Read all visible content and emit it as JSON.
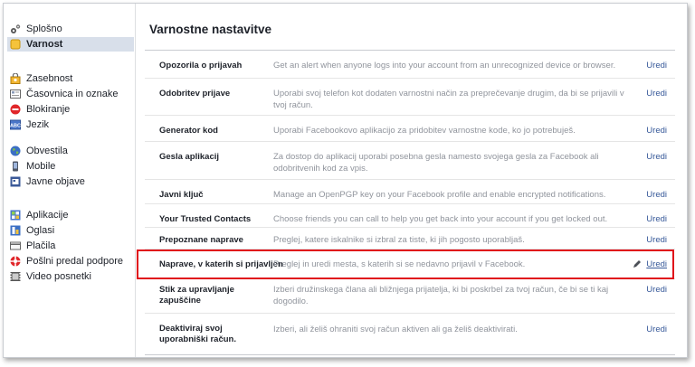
{
  "sidebar": {
    "groups": [
      [
        {
          "label": "Splošno",
          "icon": "gears-icon"
        },
        {
          "label": "Varnost",
          "icon": "shield-icon",
          "active": true
        }
      ],
      [
        {
          "label": "Zasebnost",
          "icon": "privacy-lock-icon"
        },
        {
          "label": "Časovnica in oznake",
          "icon": "timeline-icon"
        },
        {
          "label": "Blokiranje",
          "icon": "block-icon"
        },
        {
          "label": "Jezik",
          "icon": "language-icon"
        }
      ],
      [
        {
          "label": "Obvestila",
          "icon": "globe-icon"
        },
        {
          "label": "Mobile",
          "icon": "mobile-icon"
        },
        {
          "label": "Javne objave",
          "icon": "rss-icon"
        }
      ],
      [
        {
          "label": "Aplikacije",
          "icon": "apps-icon"
        },
        {
          "label": "Oglasi",
          "icon": "ads-icon"
        },
        {
          "label": "Plačila",
          "icon": "payments-icon"
        },
        {
          "label": "Pošlni predal podpore",
          "icon": "support-icon"
        },
        {
          "label": "Video posnetki",
          "icon": "video-icon"
        }
      ]
    ]
  },
  "main": {
    "title": "Varnostne nastavitve",
    "edit_label": "Uredi",
    "rows": [
      {
        "label": "Opozorila o prijavah",
        "desc": "Get an alert when anyone logs into your account from an unrecognized device or browser."
      },
      {
        "label": "Odobritev prijave",
        "desc": "Uporabi svoj telefon kot dodaten varnostni način za preprečevanje drugim, da bi se prijavili v tvoj račun."
      },
      {
        "label": "Generator kod",
        "desc": "Uporabi Facebookovo aplikacijo za pridobitev varnostne kode, ko jo potrebuješ."
      },
      {
        "label": "Gesla aplikacij",
        "desc": "Za dostop do aplikacij uporabi posebna gesla namesto svojega gesla za Facebook ali odobritvenih kod za vpis."
      },
      {
        "label": "Javni ključ",
        "desc": "Manage an OpenPGP key on your Facebook profile and enable encrypted notifications."
      },
      {
        "label": "Your Trusted Contacts",
        "desc": "Choose friends you can call to help you get back into your account if you get locked out."
      },
      {
        "label": "Prepoznane naprave",
        "desc": "Preglej, katere iskalnike si izbral za tiste, ki jih pogosto uporabljaš."
      },
      {
        "label": "Naprave, v katerih si prijavljen",
        "desc": "Preglej in uredi mesta, s katerih si se nedavno prijavil v Facebook.",
        "highlight": true
      },
      {
        "label": "Stik za upravljanje zapuščine",
        "desc": "Izberi družinskega člana ali bližnjega prijatelja, ki bi poskrbel za tvoj račun, če bi se ti kaj dogodilo."
      },
      {
        "label": "Deaktiviraj svoj uporabniški račun.",
        "desc": "Izberi, ali želiš ohraniti svoj račun aktiven ali ga želiš deaktivirati."
      }
    ]
  },
  "colors": {
    "link": "#365899",
    "highlight_border": "#e0101a",
    "active_nav_bg": "#d8dfea",
    "desc_text": "#90949c"
  }
}
